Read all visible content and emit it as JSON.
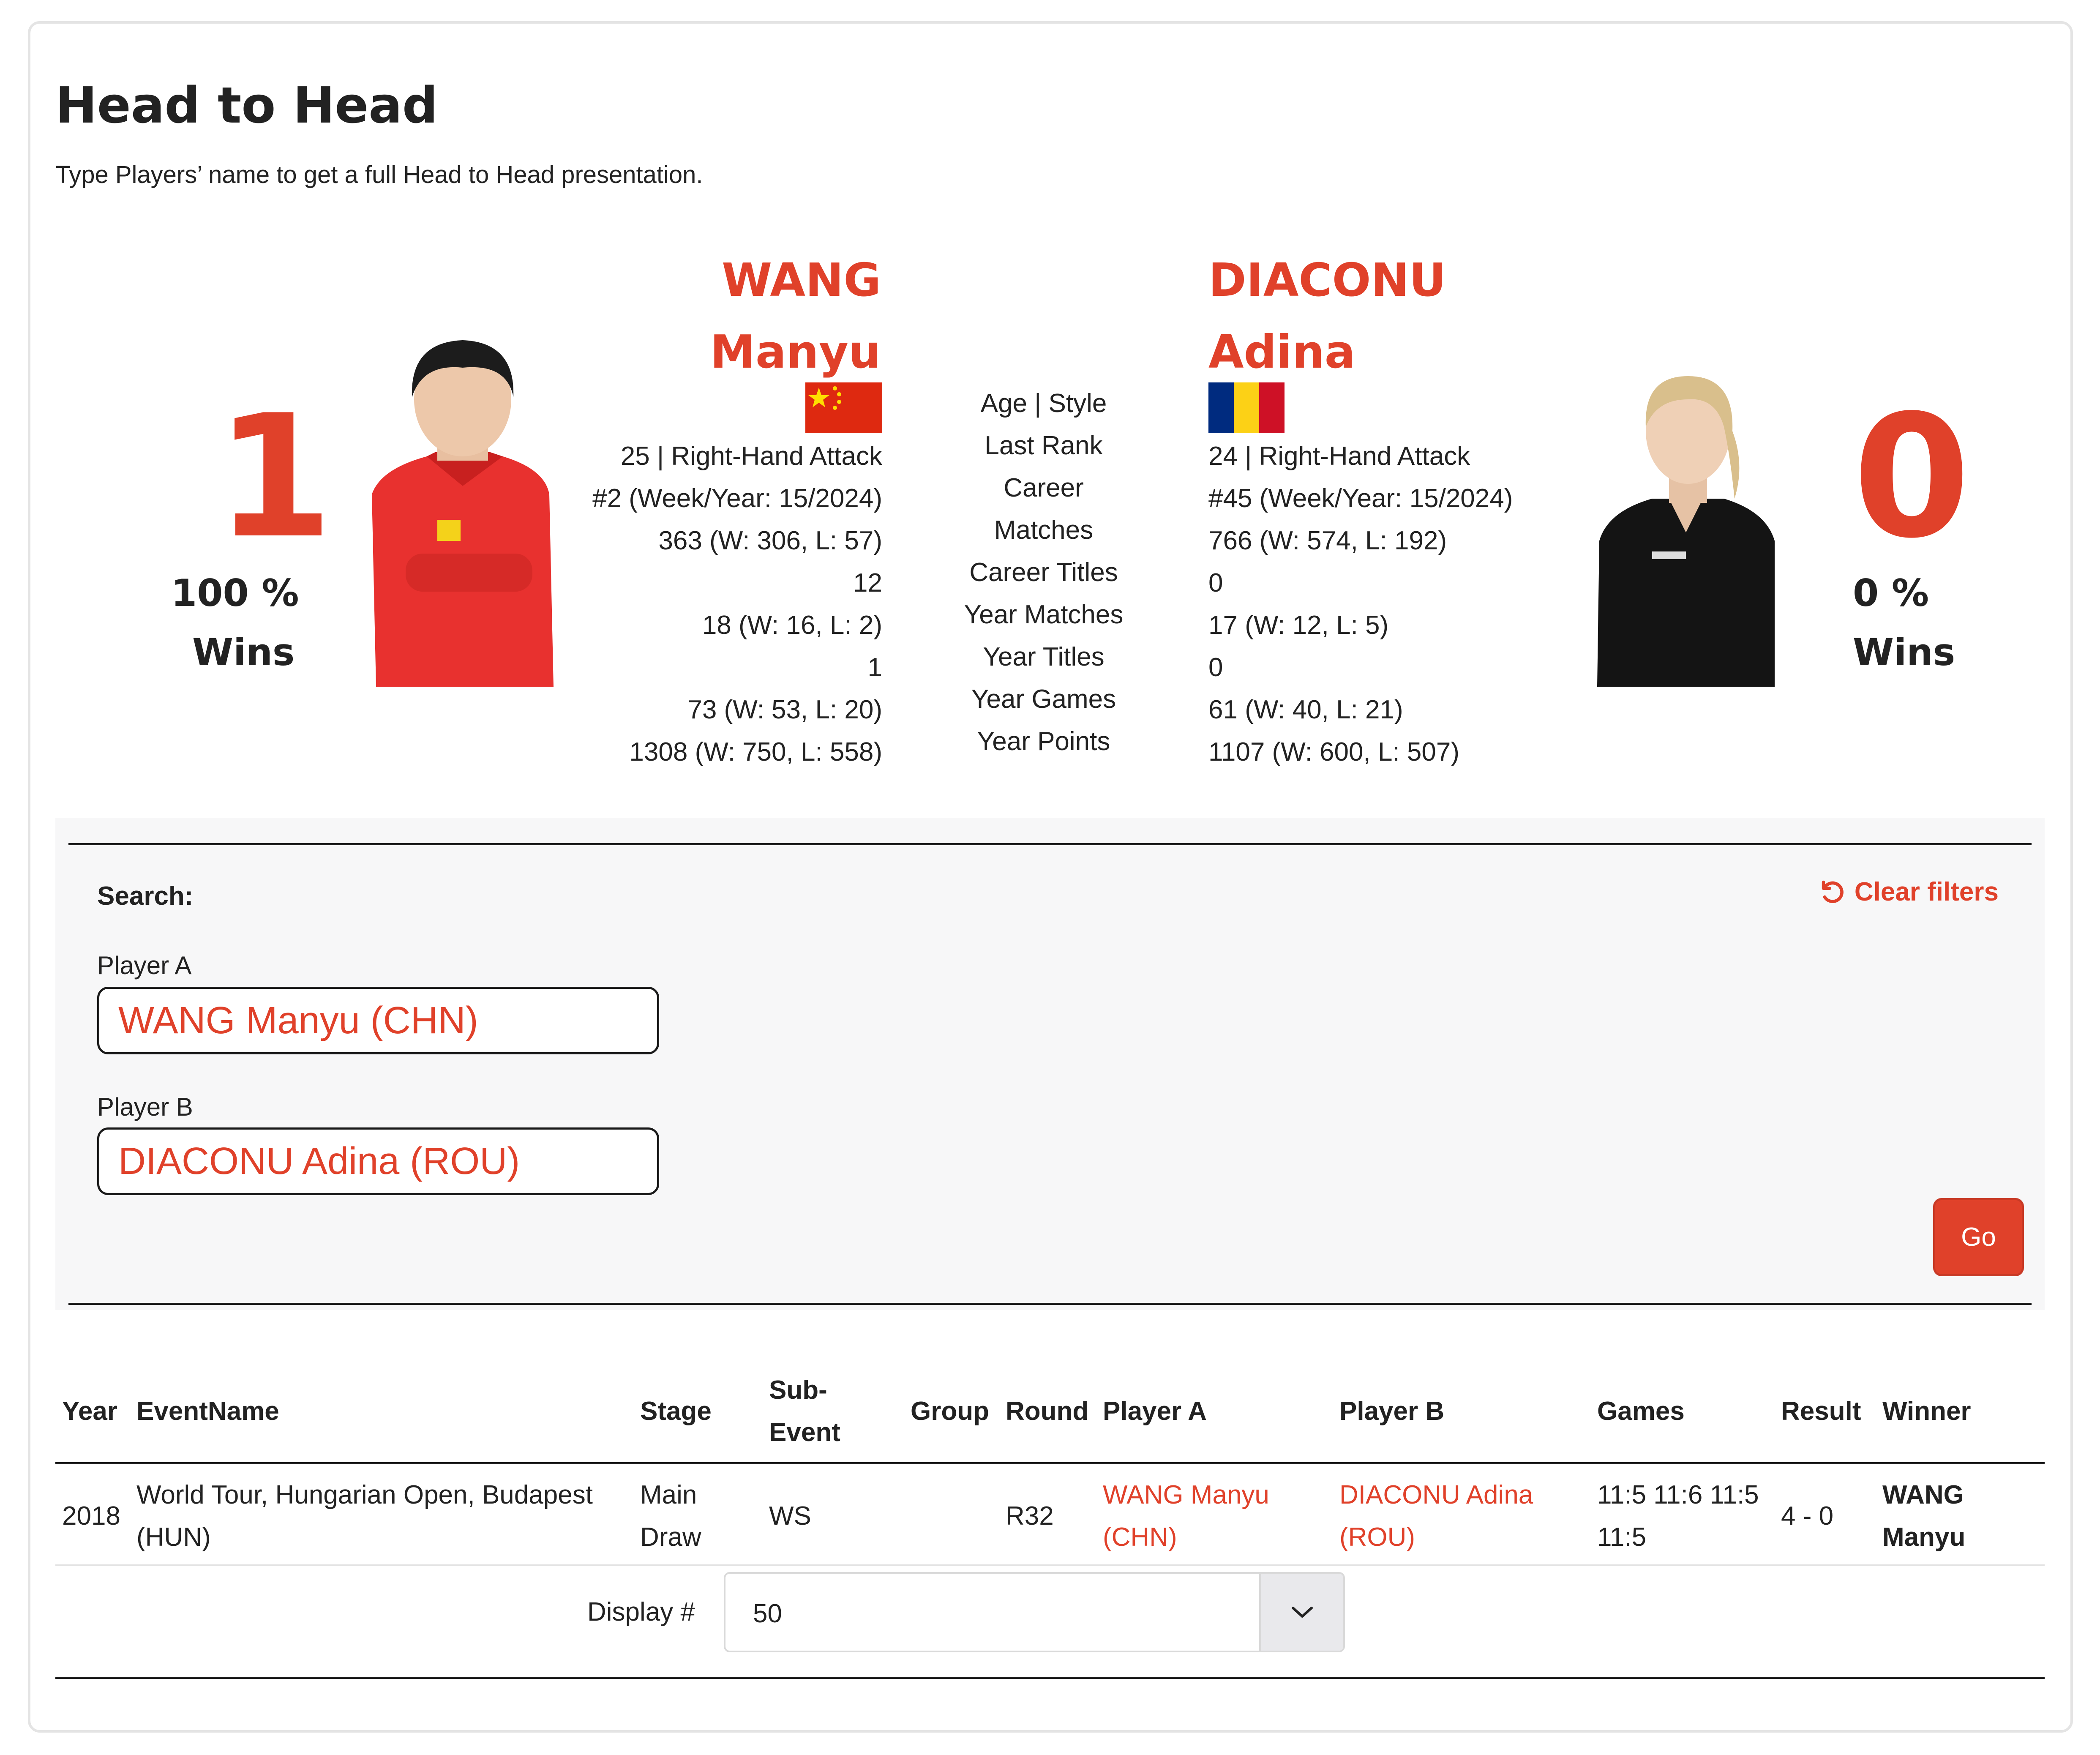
{
  "header": {
    "title": "Head to Head",
    "subtitle": "Type Players’ name to get a full Head to Head presentation."
  },
  "player_a": {
    "wins": "1",
    "win_pct": "100 %",
    "wins_label": "Wins",
    "last_name": "WANG",
    "first_name": "Manyu",
    "flag": "flag-china-icon",
    "stats": [
      "25 | Right-Hand Attack",
      "#2 (Week/Year: 15/2024)",
      "363 (W: 306, L: 57)",
      "12",
      "18 (W: 16, L: 2)",
      "1",
      "73 (W: 53, L: 20)",
      "1308 (W: 750, L: 558)"
    ]
  },
  "player_b": {
    "wins": "0",
    "win_pct": "0 %",
    "wins_label": "Wins",
    "last_name": "DIACONU",
    "first_name": "Adina",
    "flag": "flag-romania-icon",
    "stats": [
      "24 | Right-Hand Attack",
      "#45 (Week/Year: 15/2024)",
      "766 (W: 574, L: 192)",
      "0",
      "17 (W: 12, L: 5)",
      "0",
      "61 (W: 40, L: 21)",
      "1107 (W: 600, L: 507)"
    ]
  },
  "stat_labels": [
    "Age | Style",
    "Last Rank",
    "Career",
    "Matches",
    "Career Titles",
    "Year Matches",
    "Year Titles",
    "Year Games",
    "Year Points"
  ],
  "search": {
    "label": "Search:",
    "clear_filters": "Clear filters",
    "player_a_label": "Player A",
    "player_a_value": "WANG Manyu (CHN)",
    "player_b_label": "Player B",
    "player_b_value": "DIACONU Adina (ROU)",
    "go": "Go"
  },
  "table": {
    "headers": {
      "year": "Year",
      "event": "EventName",
      "stage": "Stage",
      "sub1": "Sub-",
      "sub2": "Event",
      "group": "Group",
      "round": "Round",
      "player_a": "Player A",
      "player_b": "Player B",
      "games": "Games",
      "result": "Result",
      "winner": "Winner"
    },
    "rows": [
      {
        "year": "2018",
        "event1": "World Tour, Hungarian Open, Budapest",
        "event2": "(HUN)",
        "stage1": "Main",
        "stage2": "Draw",
        "sub_event": "WS",
        "group": "",
        "round": "R32",
        "player_a1": "WANG Manyu",
        "player_a2": "(CHN)",
        "player_b1": "DIACONU Adina",
        "player_b2": "(ROU)",
        "games1": "11:5 11:6 11:5",
        "games2": "11:5",
        "result": "4 - 0",
        "winner1": "WANG",
        "winner2": "Manyu"
      }
    ]
  },
  "display": {
    "label": "Display #",
    "value": "50"
  },
  "colors": {
    "accent": "#e0412a",
    "panel": "#f7f7f8"
  }
}
